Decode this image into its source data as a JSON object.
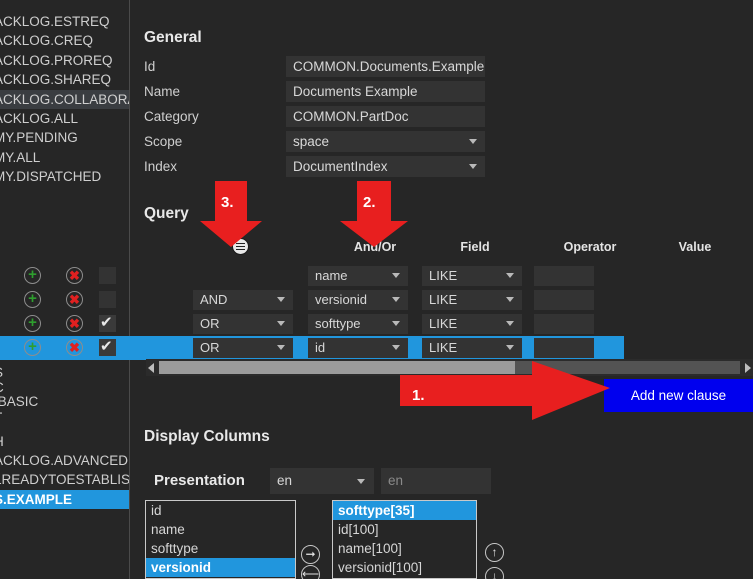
{
  "colors": {
    "background": "#262626",
    "panel": "#333333",
    "accent_blue": "#2196dd",
    "button_blue": "#0000ee",
    "annotation_red": "#e81f1f",
    "green": "#2e9e2e",
    "red_x": "#e02020"
  },
  "sidebar": {
    "items": [
      {
        "label": "ACKLOG.ESTREQ",
        "state": "normal"
      },
      {
        "label": "ACKLOG.CREQ",
        "state": "normal"
      },
      {
        "label": "ACKLOG.PROREQ",
        "state": "normal"
      },
      {
        "label": "ACKLOG.SHAREQ",
        "state": "normal"
      },
      {
        "label": "ACKLOG.COLLABORATI",
        "state": "hover"
      },
      {
        "label": "ACKLOG.ALL",
        "state": "normal"
      },
      {
        "label": "MY.PENDING",
        "state": "normal"
      },
      {
        "label": "MY.ALL",
        "state": "normal"
      },
      {
        "label": "MY.DISPATCHED",
        "state": "normal"
      },
      {
        "label": "S",
        "state": "normal"
      },
      {
        "label": "C",
        "state": "normal"
      },
      {
        "label": ".BASIC",
        "state": "normal"
      },
      {
        "label": "T",
        "state": "normal"
      },
      {
        "label": "H",
        "state": "normal"
      },
      {
        "label": "ACKLOG.ADVANCED",
        "state": "normal"
      },
      {
        "label": "LREADYTOESTABLISH",
        "state": "normal"
      },
      {
        "label": "S.EXAMPLE",
        "state": "selected"
      }
    ]
  },
  "general": {
    "title": "General",
    "fields": [
      {
        "label": "Id",
        "value": "COMMON.Documents.Example",
        "type": "text"
      },
      {
        "label": "Name",
        "value": "Documents Example",
        "type": "text"
      },
      {
        "label": "Category",
        "value": "COMMON.PartDoc",
        "type": "text"
      },
      {
        "label": "Scope",
        "value": "space",
        "type": "select"
      },
      {
        "label": "Index",
        "value": "DocumentIndex",
        "type": "select"
      }
    ]
  },
  "query": {
    "title": "Query",
    "grid_menu_icon": "hamburger-menu-icon",
    "columns": [
      "And/Or",
      "Field",
      "Operator",
      "Value"
    ],
    "rows": [
      {
        "add_icon": "plus-icon",
        "delete_icon": "delete-x-icon",
        "checked": false,
        "andor": "",
        "field": "name",
        "operator": "LIKE",
        "value": "",
        "selected": false
      },
      {
        "add_icon": "plus-icon",
        "delete_icon": "delete-x-icon",
        "checked": false,
        "andor": "AND",
        "field": "versionid",
        "operator": "LIKE",
        "value": "",
        "selected": false
      },
      {
        "add_icon": "plus-icon",
        "delete_icon": "delete-x-icon",
        "checked": true,
        "andor": "OR",
        "field": "softtype",
        "operator": "LIKE",
        "value": "",
        "selected": false
      },
      {
        "add_icon": "plus-icon",
        "delete_icon": "delete-x-icon",
        "checked": true,
        "andor": "OR",
        "field": "id",
        "operator": "LIKE",
        "value": "",
        "selected": true
      }
    ],
    "add_clause_label": "Add new clause",
    "scrollbar": {
      "left_arrow_icon": "scroll-left-icon",
      "right_arrow_icon": "scroll-right-icon"
    }
  },
  "display_columns": {
    "title": "Display Columns",
    "presentation_label": "Presentation",
    "presentation_value": "en",
    "presentation_placeholder": "en",
    "available": [
      {
        "label": "id",
        "selected": false
      },
      {
        "label": "name",
        "selected": false
      },
      {
        "label": "softtype",
        "selected": false
      },
      {
        "label": "versionid",
        "selected": true
      }
    ],
    "chosen": [
      {
        "label": "softtype[35]",
        "selected": true
      },
      {
        "label": "id[100]",
        "selected": false
      },
      {
        "label": "name[100]",
        "selected": false
      },
      {
        "label": "versionid[100]",
        "selected": false
      }
    ],
    "move_right_icon": "arrow-right-circle-icon",
    "move_left_icon": "arrow-left-circle-icon",
    "move_up_icon": "arrow-up-circle-icon",
    "move_down_icon": "arrow-down-circle-icon"
  },
  "annotations": [
    {
      "number": "1.",
      "points_to": "Add new clause"
    },
    {
      "number": "2.",
      "points_to": "And/Or column"
    },
    {
      "number": "3.",
      "points_to": "grid menu icon"
    }
  ]
}
